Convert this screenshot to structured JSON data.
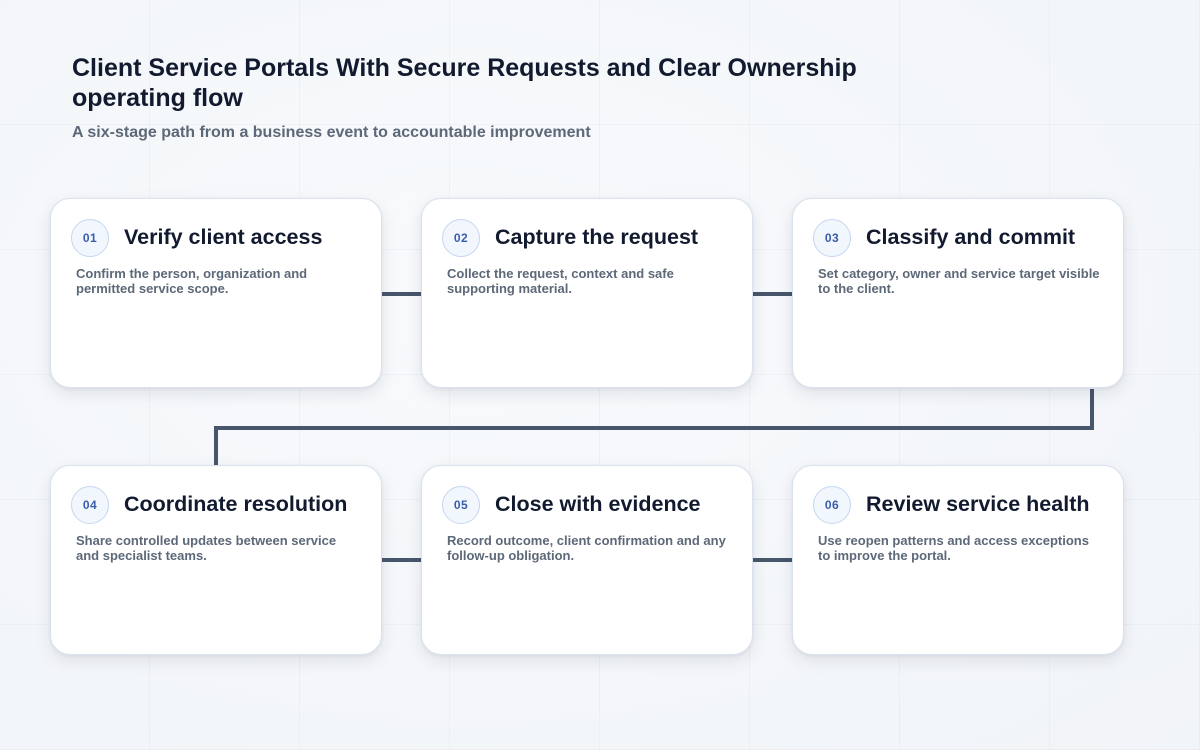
{
  "header": {
    "title": "Client Service Portals With Secure Requests and Clear Ownership operating flow",
    "subtitle": "A six-stage path from a business event to accountable improvement"
  },
  "stages": [
    {
      "number": "01",
      "title": "Verify client access",
      "description": "Confirm the person, organization and permitted service scope."
    },
    {
      "number": "02",
      "title": "Capture the request",
      "description": "Collect the request, context and safe supporting material."
    },
    {
      "number": "03",
      "title": "Classify and commit",
      "description": "Set category, owner and service target visible to the client."
    },
    {
      "number": "04",
      "title": "Coordinate resolution",
      "description": "Share controlled updates between service and specialist teams."
    },
    {
      "number": "05",
      "title": "Close with evidence",
      "description": "Record outcome, client confirmation and any follow-up obligation."
    },
    {
      "number": "06",
      "title": "Review service health",
      "description": "Use reopen patterns and access exceptions to improve the portal."
    }
  ],
  "flow": [
    [
      "01",
      "02"
    ],
    [
      "02",
      "03"
    ],
    [
      "03",
      "04"
    ],
    [
      "04",
      "05"
    ],
    [
      "05",
      "06"
    ]
  ],
  "colors": {
    "connector": "#48566b",
    "badge_text": "#3a5dab",
    "badge_border": "#c7d7f1",
    "title_text": "#111a2e",
    "body_text": "#5d6878"
  }
}
